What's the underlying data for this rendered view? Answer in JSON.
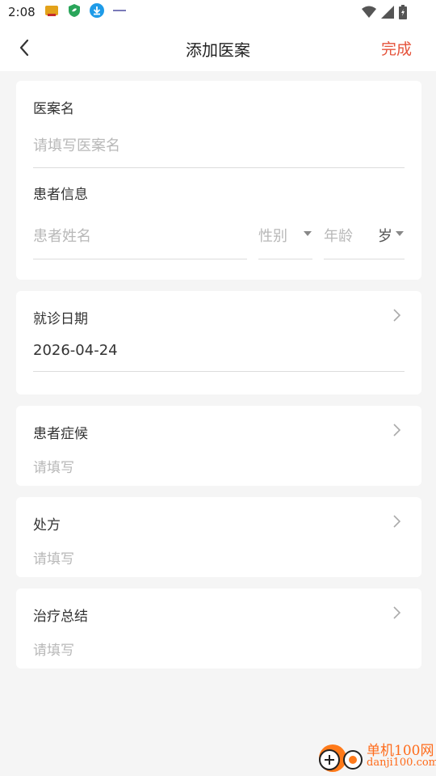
{
  "status_bar": {
    "time": "2:08",
    "icons": [
      "app-notification-icon",
      "shield-leaf-icon",
      "download-icon",
      "app-badge-icon"
    ],
    "right_icons": [
      "wifi-icon",
      "signal-icon",
      "battery-icon"
    ]
  },
  "header": {
    "title": "添加医案",
    "done_label": "完成"
  },
  "case_card": {
    "name_label": "医案名",
    "name_placeholder": "请填写医案名",
    "patient_label": "患者信息",
    "patient_name_placeholder": "患者姓名",
    "gender_placeholder": "性别",
    "age_placeholder": "年龄",
    "age_unit": "岁"
  },
  "visit_card": {
    "label": "就诊日期",
    "value": "2026-04-24"
  },
  "symptoms_card": {
    "label": "患者症候",
    "placeholder": "请填写"
  },
  "prescription_card": {
    "label": "处方",
    "placeholder": "请填写"
  },
  "summary_card": {
    "label": "治疗总结",
    "placeholder": "请填写"
  },
  "watermark": {
    "line1": "单机100网",
    "line2": "danji100.com"
  },
  "colors": {
    "accent": "#e5533b",
    "background": "#f5f5f5",
    "placeholder": "#b8b8b8"
  }
}
